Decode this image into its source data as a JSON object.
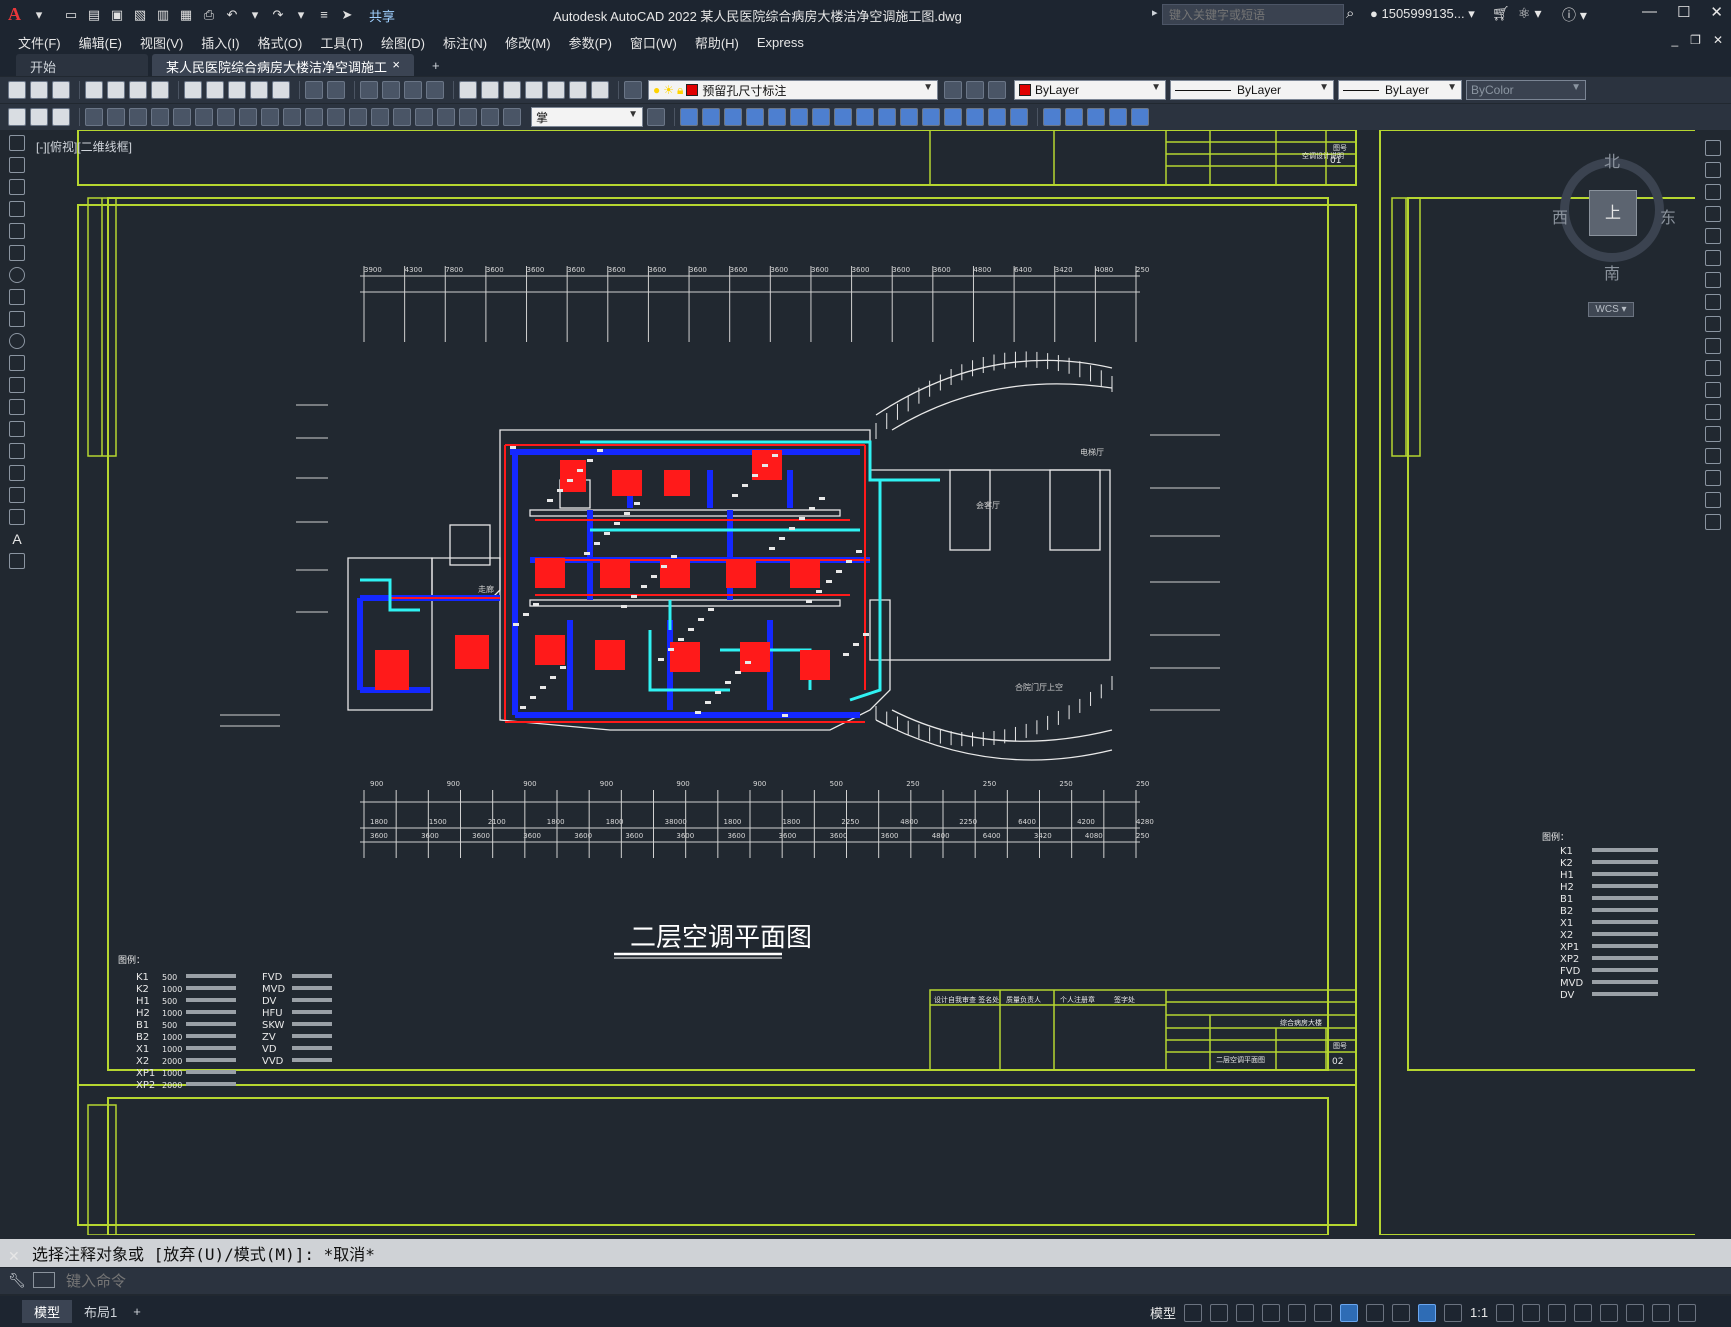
{
  "titlebar": {
    "app_letter": "A",
    "share_label": "共享",
    "title": "Autodesk AutoCAD 2022    某人民医院综合病房大楼洁净空调施工图.dwg",
    "search_placeholder": "键入关键字或短语",
    "user": "1505999135...",
    "cart_icon": "cart-icon"
  },
  "menubar": {
    "items": [
      "文件(F)",
      "编辑(E)",
      "视图(V)",
      "插入(I)",
      "格式(O)",
      "工具(T)",
      "绘图(D)",
      "标注(N)",
      "修改(M)",
      "参数(P)",
      "窗口(W)",
      "帮助(H)",
      "Express"
    ]
  },
  "tabs": {
    "start": "开始",
    "active": "某人民医院综合病房大楼洁净空调施工图*",
    "close": "×",
    "plus": "+"
  },
  "toolbar": {
    "layer_name": "预留孔尺寸标注",
    "color": "ByLayer",
    "linetype": "ByLayer",
    "lineweight": "ByLayer",
    "plotstyle": "ByColor",
    "text_style": "掌"
  },
  "viewport": {
    "label": "[-][俯视][二维线框]"
  },
  "drawing": {
    "plan_title": "二层空调平面图",
    "legend_head": "图例：",
    "legend_codes_left": [
      "K1",
      "K2",
      "H1",
      "H2",
      "B1",
      "B2",
      "X1",
      "X2",
      "XP1",
      "XP2"
    ],
    "legend_codes_mid": [
      "FVD",
      "MVD",
      "DV",
      "HFU",
      "SKW",
      "ZV",
      "VD",
      "VVD"
    ],
    "legend_codes_right": [
      "K1",
      "K2",
      "H1",
      "H2",
      "B1",
      "B2",
      "X1",
      "X2",
      "XP1",
      "XP2",
      "FVD",
      "MVD",
      "DV"
    ],
    "legend_values_left": [
      "500",
      "1000",
      "500",
      "1000",
      "500",
      "1000",
      "1000",
      "2000",
      "1000",
      "2000"
    ],
    "top_dims": [
      "3900",
      "4300",
      "7800",
      "3600",
      "3600",
      "3600",
      "3600",
      "3600",
      "3600",
      "3600",
      "3600",
      "3600",
      "3600",
      "3600",
      "3600",
      "4800",
      "6400",
      "3420",
      "4080",
      "250"
    ],
    "bottom_dims_a": [
      "900",
      "900",
      "900",
      "900",
      "900",
      "900",
      "500",
      "250",
      "250",
      "250",
      "250"
    ],
    "bottom_dims_b": [
      "1800",
      "1500",
      "2100",
      "1800",
      "1800",
      "38000",
      "1800",
      "1800",
      "2250",
      "4800",
      "2250",
      "6400",
      "4200",
      "4280"
    ],
    "bottom_dims_c": [
      "3600",
      "3600",
      "3600",
      "3600",
      "3600",
      "3600",
      "3600",
      "3600",
      "3600",
      "3600",
      "3600",
      "4800",
      "6400",
      "3420",
      "4080",
      "250"
    ],
    "sheet_no_top": "01",
    "sheet_no_bottom": "02",
    "sheet_label": "图号",
    "title_block_project": "综合病房大楼",
    "title_block_drawing": "二层空调平面图",
    "title_block_top_drawing": "空调设计说明",
    "stamp_text_1": "设计自我审查 签名处",
    "stamp_text_2": "质量负责人",
    "stamp_text_3": "个人注册章",
    "stamp_text_4": "签字处",
    "rooms": [
      "电梯厅",
      "会客厅",
      "合院门厅上空",
      "走廊"
    ],
    "right_legend_head": "图例："
  },
  "viewcube": {
    "north": "北",
    "south": "南",
    "east": "东",
    "west": "西",
    "top": "上",
    "wcs": "WCS"
  },
  "command": {
    "history": "选择注释对象或 [放弃(U)/模式(M)]: *取消*",
    "placeholder": "键入命令"
  },
  "status": {
    "model_tab": "模型",
    "layout_tab": "布局1",
    "plus": "+",
    "model_btn": "模型",
    "scale": "1:1"
  },
  "colors": {
    "frame_green": "#b6d630",
    "duct_red": "#ff1a1a",
    "duct_blue": "#1428ff",
    "duct_cyan": "#2ff2f2",
    "wall_white": "#e8e8e8"
  }
}
